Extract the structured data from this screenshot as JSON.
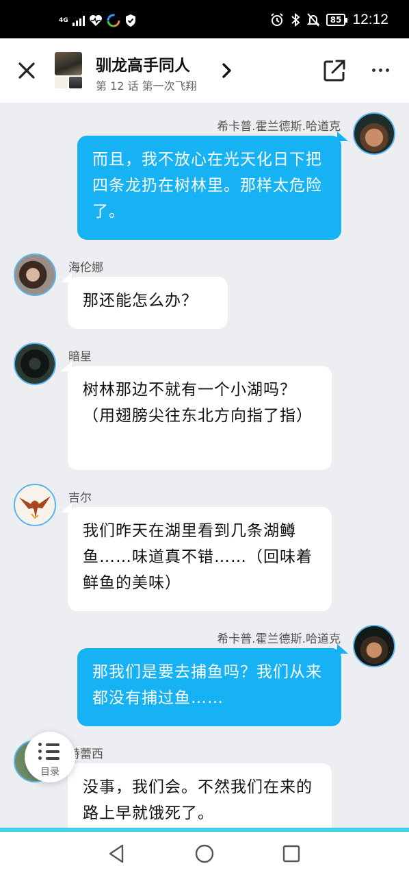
{
  "status_bar": {
    "network": "4G",
    "battery": "85",
    "time": "12:12"
  },
  "header": {
    "title": "驯龙高手同人",
    "subtitle": "第 12 话 第一次飞翔"
  },
  "messages": [
    {
      "sender": "希卡普.霍兰德斯.哈道克",
      "side": "right",
      "text": "而且，我不放心在光天化日下把四条龙扔在树林里。那样太危险了。"
    },
    {
      "sender": "海伦娜",
      "side": "left",
      "text": "那还能怎么办？"
    },
    {
      "sender": "暗星",
      "side": "left",
      "text": "树林那边不就有一个小湖吗？（用翅膀尖往东北方向指了指）"
    },
    {
      "sender": "吉尔",
      "side": "left",
      "text": "我们昨天在湖里看到几条湖鳟鱼……味道真不错……（回味着鲜鱼的美味）"
    },
    {
      "sender": "希卡普.霍兰德斯.哈道克",
      "side": "right",
      "text": "那我们是要去捕鱼吗？我们从来都没有捕过鱼……"
    },
    {
      "sender": "特蕾西",
      "side": "left",
      "text": "没事，我们会。不然我们在来的路上早就饿死了。"
    }
  ],
  "floating": {
    "toc_label": "目录"
  },
  "icons": {
    "close": "close-icon",
    "chevron": "chevron-right-icon",
    "share": "share-icon",
    "more": "more-icon",
    "toc": "list-icon",
    "back": "back-icon",
    "home": "home-icon",
    "recents": "recents-icon"
  },
  "colors": {
    "bubble_self": "#16b2f4",
    "bubble_other": "#ffffff",
    "background": "#eceef1",
    "avatar_border": "#5ab4ea",
    "accent": "#3fd3e6"
  }
}
